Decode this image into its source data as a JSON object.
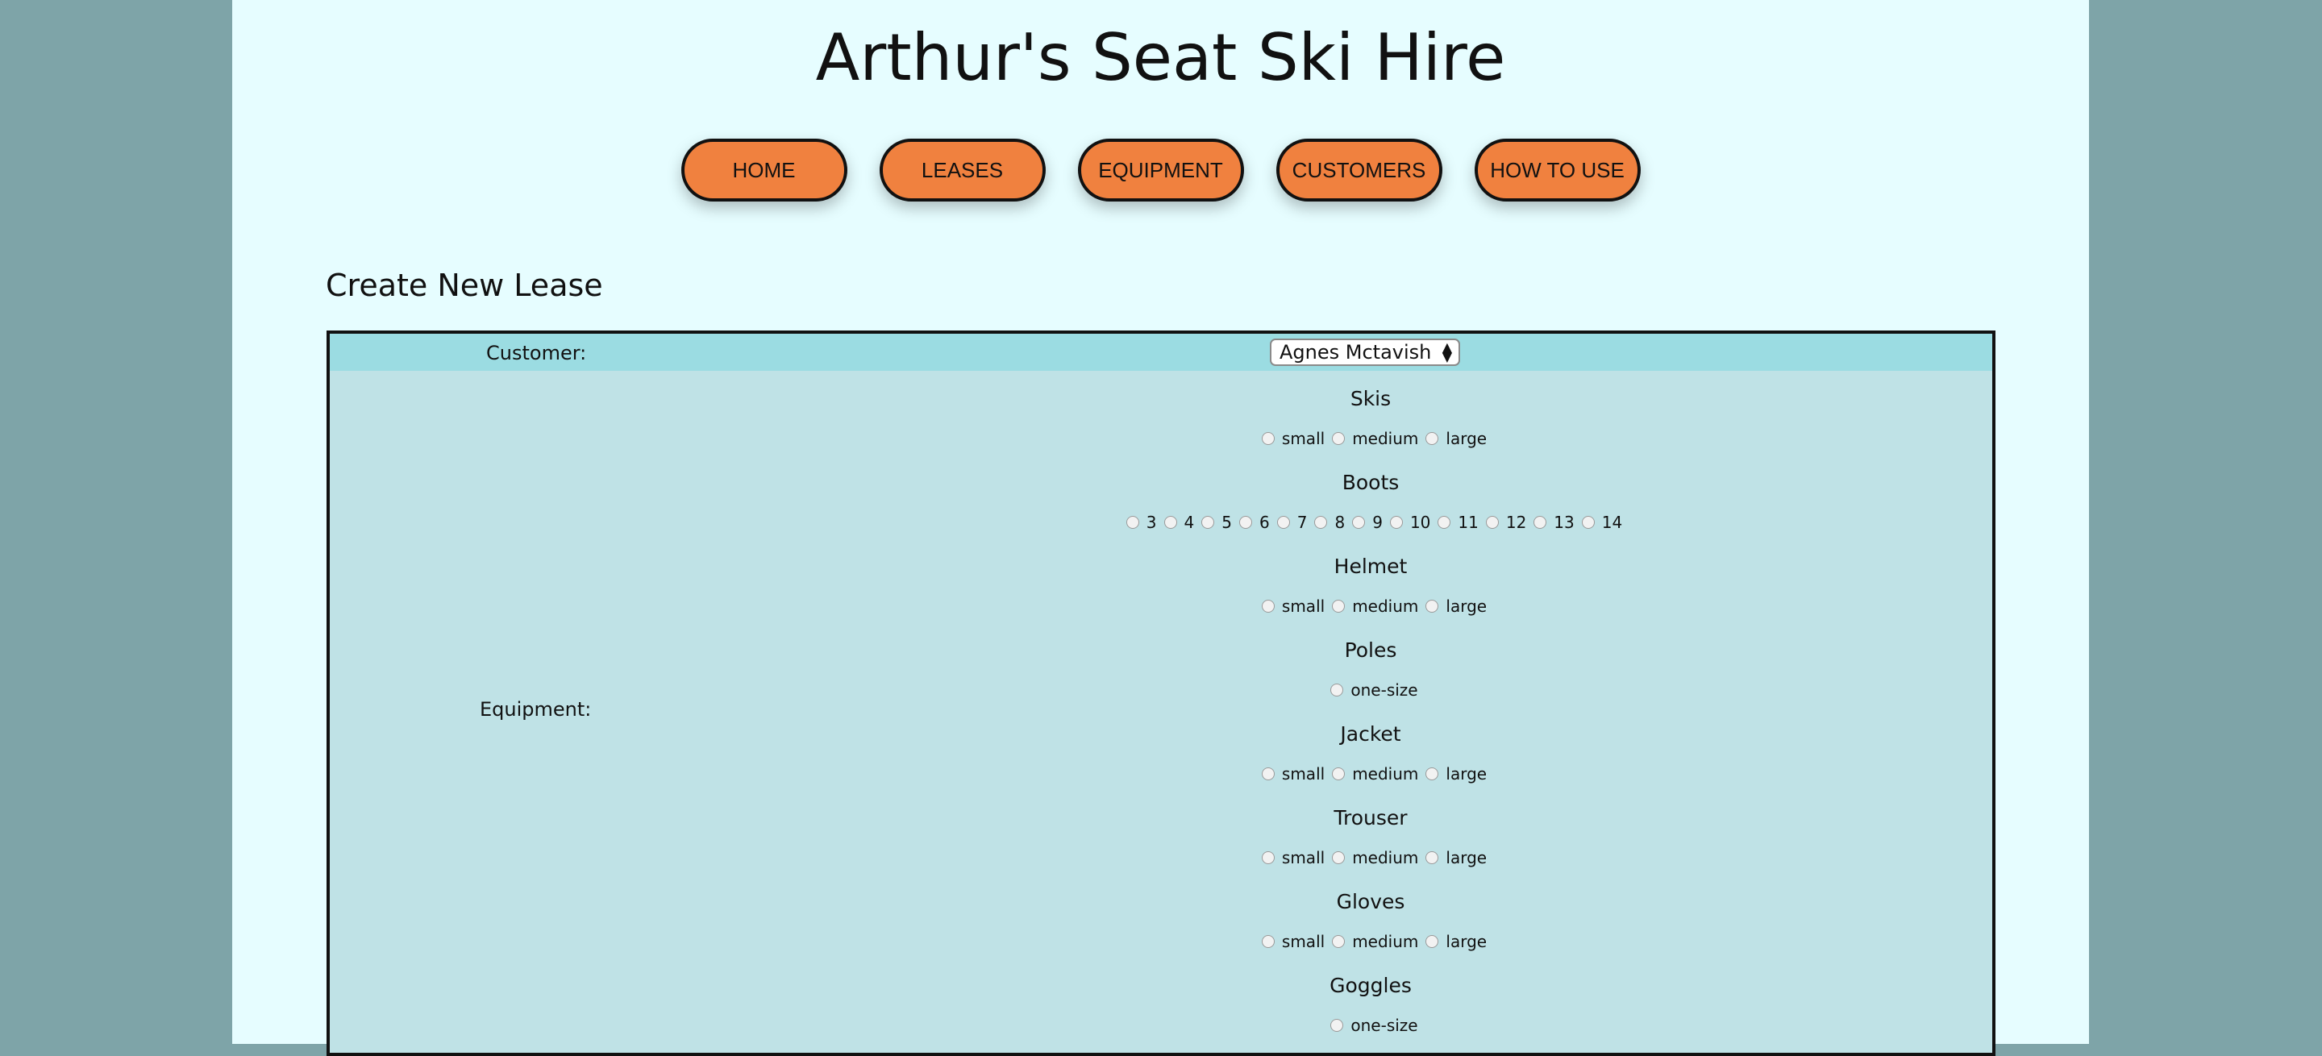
{
  "site_title": "Arthur's Seat Ski Hire",
  "nav": [
    "HOME",
    "LEASES",
    "EQUIPMENT",
    "CUSTOMERS",
    "HOW TO USE"
  ],
  "section_title": "Create New Lease",
  "form": {
    "customer_label": "Customer:",
    "customer_selected": "Agnes Mctavish",
    "equipment_label": "Equipment:",
    "equipment": [
      {
        "name": "Skis",
        "options": [
          "small",
          "medium",
          "large"
        ]
      },
      {
        "name": "Boots",
        "options": [
          "3",
          "4",
          "5",
          "6",
          "7",
          "8",
          "9",
          "10",
          "11",
          "12",
          "13",
          "14"
        ]
      },
      {
        "name": "Helmet",
        "options": [
          "small",
          "medium",
          "large"
        ]
      },
      {
        "name": "Poles",
        "options": [
          "one-size"
        ]
      },
      {
        "name": "Jacket",
        "options": [
          "small",
          "medium",
          "large"
        ]
      },
      {
        "name": "Trouser",
        "options": [
          "small",
          "medium",
          "large"
        ]
      },
      {
        "name": "Gloves",
        "options": [
          "small",
          "medium",
          "large"
        ]
      },
      {
        "name": "Goggles",
        "options": [
          "one-size"
        ]
      }
    ]
  },
  "colors": {
    "background": "#7ea4a8",
    "page": "#e6fdff",
    "nav_button": "#f0813f",
    "customer_row": "#9bdce2",
    "form_body": "#bfe2e6"
  }
}
